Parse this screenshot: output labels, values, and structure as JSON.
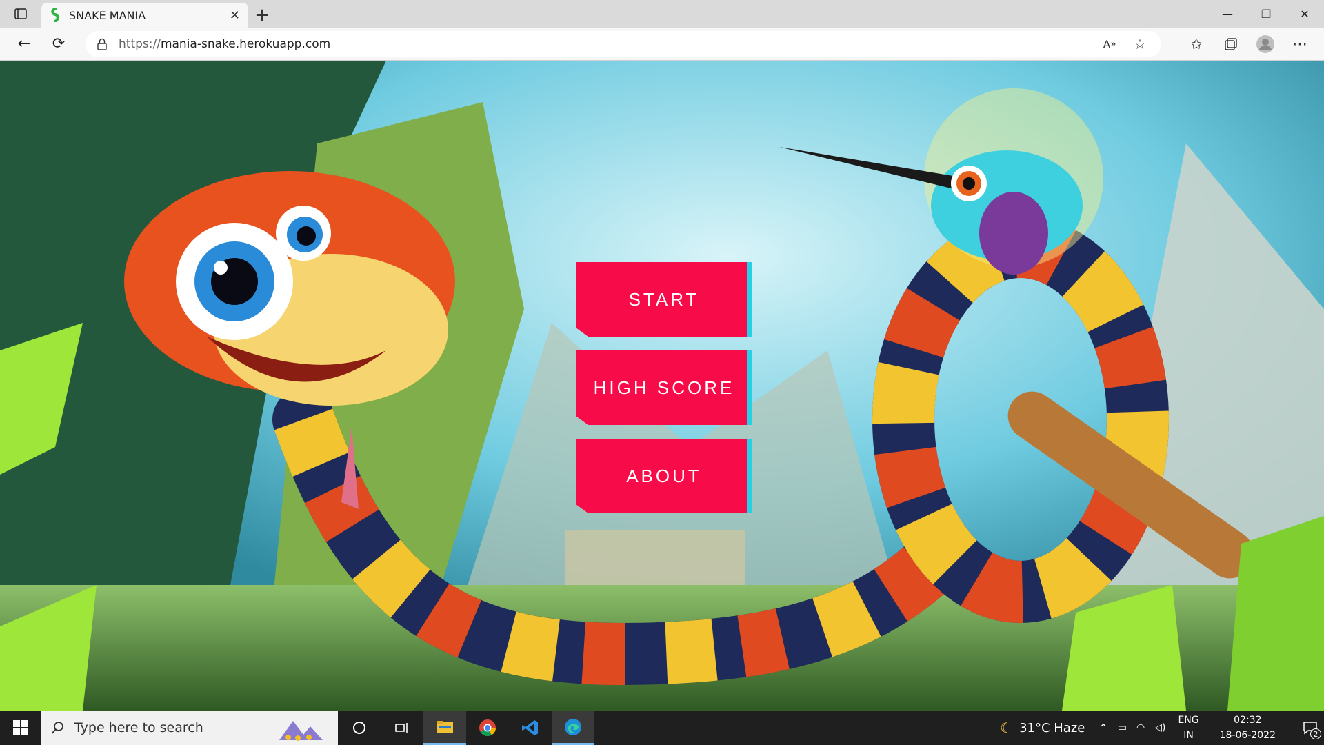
{
  "browser": {
    "tab_title": "SNAKE MANIA",
    "url_protocol": "https://",
    "url_host": "mania-snake.herokuapp.com"
  },
  "game": {
    "menu": [
      {
        "label": "START"
      },
      {
        "label": "HIGH SCORE"
      },
      {
        "label": "ABOUT"
      }
    ],
    "colors": {
      "button": "#f70b48",
      "button_accent": "#25d1e6"
    }
  },
  "taskbar": {
    "search_placeholder": "Type here to search",
    "weather": "31°C  Haze",
    "lang_top": "ENG",
    "lang_bottom": "IN",
    "time": "02:32",
    "date": "18-06-2022",
    "notification_count": "2"
  }
}
